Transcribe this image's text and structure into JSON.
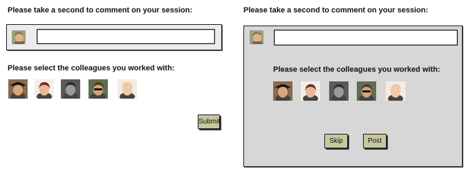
{
  "left": {
    "comment_prompt": "Please take a second to comment on your session:",
    "comment_value": "",
    "colleagues_prompt": "Please select the colleagues you worked with:",
    "submit_label": "Submit"
  },
  "right": {
    "comment_prompt": "Please take a second to comment on your session:",
    "comment_value": "",
    "colleagues_prompt": "Please select the colleagues you worked with:",
    "skip_label": "Skip",
    "post_label": "Post"
  },
  "colleagues": [
    {
      "name": "colleague-1",
      "hair": "#2b1d14",
      "skin": "#d9a77f",
      "bg": "#8a6a4a",
      "hat": true
    },
    {
      "name": "colleague-2",
      "hair": "#7a2a1a",
      "skin": "#e8b89a",
      "bg": "#f2efe9"
    },
    {
      "name": "colleague-3",
      "hair": "#303030",
      "skin": "#9a9a9a",
      "bg": "#5a5a5a"
    },
    {
      "name": "colleague-4",
      "hair": "#5a3c22",
      "skin": "#d7a07a",
      "bg": "#5f6e52",
      "glasses": true
    },
    {
      "name": "colleague-5",
      "hair": "#e7c9a5",
      "skin": "#f2c8a8",
      "bg": "#f4ece2"
    }
  ],
  "user_avatar": {
    "hair": "#8a6b3a",
    "skin": "#e0b28f",
    "bg": "#9aa27a"
  }
}
